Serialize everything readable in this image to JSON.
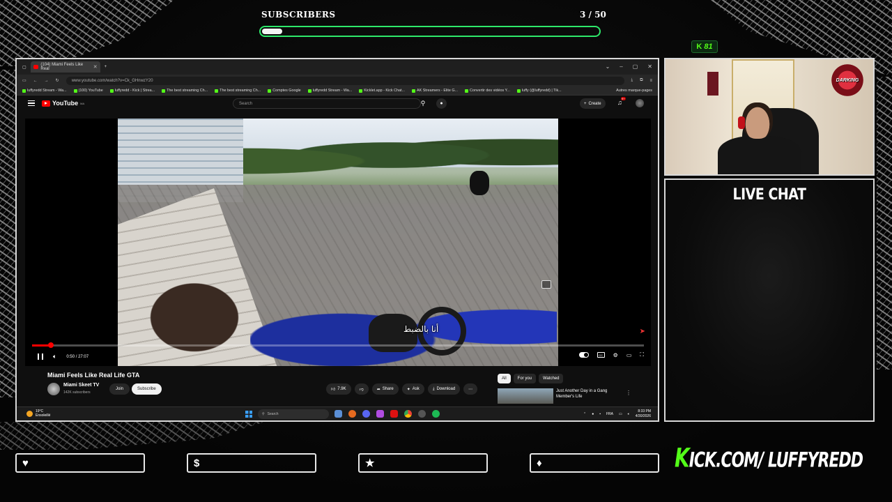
{
  "overlay": {
    "subscribers_label": "SUBSCRIBERS",
    "subscribers_count": "3 / 50",
    "subscribers_progress": 0.06,
    "kick_viewers": "81",
    "live_chat_title": "LIVE CHAT",
    "kick_url_k": "K",
    "kick_url_rest": "ICK.COM/ LUFFYREDD",
    "accent_green": "#53fc18",
    "webcam_logo": "DARKING"
  },
  "socials": [
    {
      "icon": "heart-icon",
      "glyph": "♥"
    },
    {
      "icon": "dollar-icon",
      "glyph": "$"
    },
    {
      "icon": "star-icon",
      "glyph": "★"
    },
    {
      "icon": "drop-icon",
      "glyph": "♦"
    }
  ],
  "browser": {
    "tab_title": "(104) Miami Feels Like Real",
    "url": "www.youtube.com/watch?v=Ck_GHnwzY20",
    "bookmarks": [
      "luffyredd Stream - Wa...",
      "(100) YouTube",
      "luffyredd - Kick | Strea...",
      "The best streaming Ch...",
      "The best streaming Ch...",
      "Comptes Google",
      "luffyredd Stream - Wa...",
      "Kicklet.app - Kick Chat...",
      "AK Streamers - Elite G...",
      "Convertir des vidéos Y...",
      "luffy (@luffyredd) | Tik..."
    ],
    "bookmarks_other": "Autres marque-pages"
  },
  "youtube": {
    "logo": "YouTube",
    "region": "MA",
    "search_placeholder": "Search",
    "create_label": "Create",
    "notif_count": "9+",
    "subtitle_text": "أنا بالضبط",
    "time": "0:50 / 27:07",
    "progress": 0.031,
    "video_title": "Miami Feels Like Real Life GTA",
    "channel_name": "Miami Skeet TV",
    "channel_subs": "142K subscribers",
    "join_label": "Join",
    "subscribe_label": "Subscribe",
    "like_count": "7.9K",
    "share_label": "Share",
    "ask_label": "Ask",
    "download_label": "Download",
    "filters": [
      "All",
      "For you",
      "Watched"
    ],
    "rec_title": "Just Another Day in a Gang Member's Life"
  },
  "taskbar": {
    "temp": "19°C",
    "weather": "Ensoleillé",
    "search": "Search",
    "lang": "FRA",
    "time": "8:33 PM",
    "date": "4/30/2026"
  }
}
